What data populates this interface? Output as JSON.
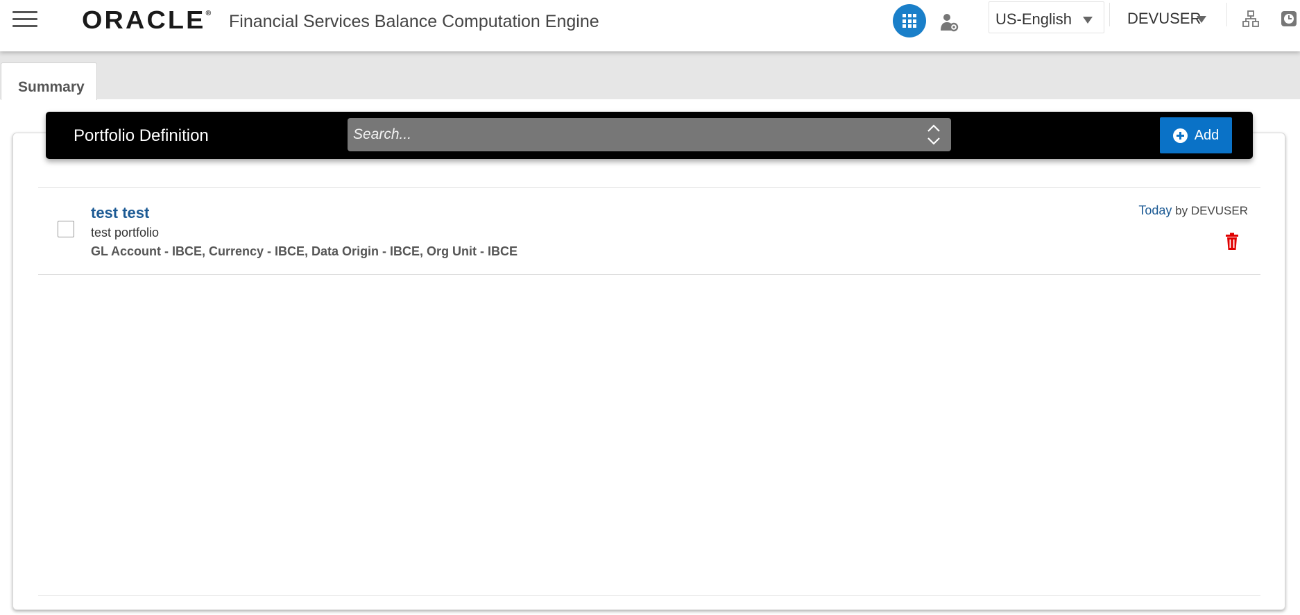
{
  "header": {
    "logo_text": "ORACLE",
    "logo_mark": "®",
    "app_title": "Financial Services Balance Computation Engine",
    "language": "US-English",
    "user": "DEVUSER"
  },
  "tabs": [
    {
      "label": "Summary"
    }
  ],
  "toolbar": {
    "title": "Portfolio Definition",
    "search_placeholder": "Search...",
    "add_label": "Add"
  },
  "list": {
    "items": [
      {
        "name": "test test",
        "description": "test portfolio",
        "dimensions": "GL Account - IBCE, Currency - IBCE, Data Origin - IBCE, Org Unit - IBCE",
        "modified": "Today",
        "by_label": "by",
        "modified_by": "DEVUSER"
      }
    ]
  },
  "colors": {
    "accent": "#1a7fc9",
    "add_button": "#0a72c7",
    "toolbar_bg": "#000000",
    "search_bg": "#777777",
    "link": "#1c5a94",
    "delete": "#e00000"
  },
  "icons": [
    "hamburger-menu-icon",
    "apps-grid-icon",
    "user-settings-icon",
    "chevron-down-icon",
    "hierarchy-icon",
    "clock-icon",
    "sort-toggle-icon",
    "plus-circle-icon",
    "trash-icon"
  ]
}
